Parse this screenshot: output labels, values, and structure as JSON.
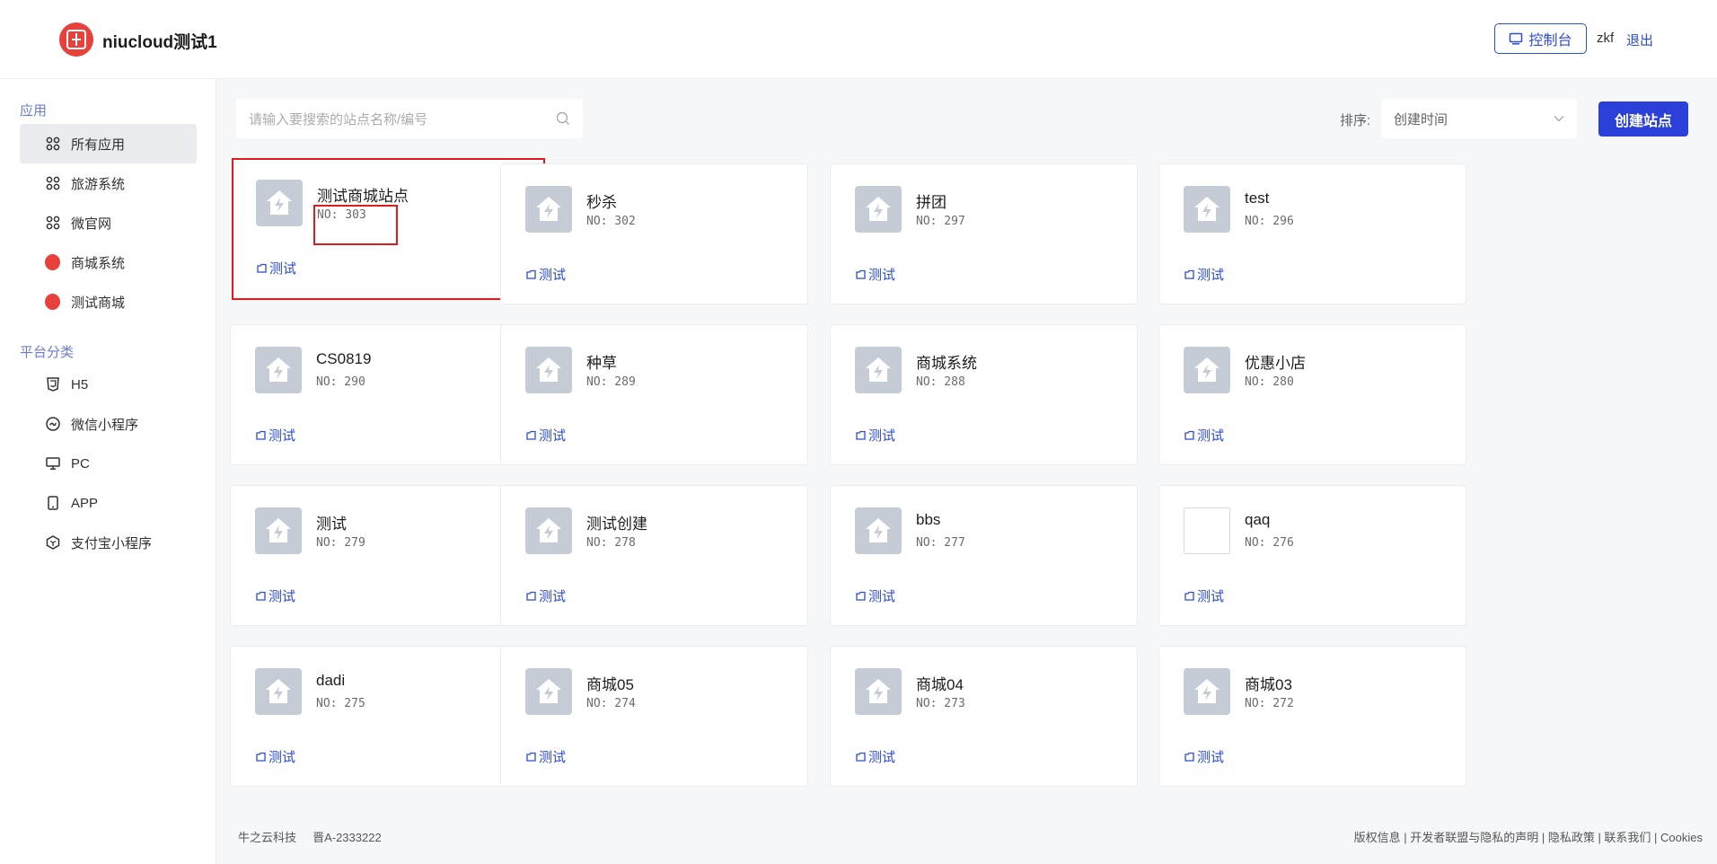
{
  "header": {
    "app_title": "niucloud测试1",
    "console_label": "控制台",
    "user_name": "zkf",
    "logout_label": "退出"
  },
  "sidebar": {
    "section_apps": "应用",
    "apps": [
      {
        "label": "所有应用",
        "icon": "grid-icon",
        "active": true
      },
      {
        "label": "旅游系统",
        "icon": "grid-icon"
      },
      {
        "label": "微官网",
        "icon": "grid-icon"
      },
      {
        "label": "商城系统",
        "icon": "app-logo-icon"
      },
      {
        "label": "测试商城",
        "icon": "app-logo-icon"
      }
    ],
    "section_platforms": "平台分类",
    "platforms": [
      {
        "label": "H5",
        "icon": "html5-icon"
      },
      {
        "label": "微信小程序",
        "icon": "mini-program-icon"
      },
      {
        "label": "PC",
        "icon": "monitor-icon"
      },
      {
        "label": "APP",
        "icon": "phone-icon"
      },
      {
        "label": "支付宝小程序",
        "icon": "alipay-icon"
      }
    ]
  },
  "toolbar": {
    "search_placeholder": "请输入要搜索的站点名称/编号",
    "sort_label": "排序:",
    "sort_value": "创建时间",
    "create_label": "创建站点"
  },
  "sites": [
    {
      "name": "测试商城站点",
      "no": "NO: 303",
      "tag": "测试"
    },
    {
      "name": "秒杀",
      "no": "NO: 302",
      "tag": "测试"
    },
    {
      "name": "拼团",
      "no": "NO: 297",
      "tag": "测试"
    },
    {
      "name": "test",
      "no": "NO: 296",
      "tag": "测试"
    },
    {
      "name": "CS0819",
      "no": "NO: 290",
      "tag": "测试"
    },
    {
      "name": "种草",
      "no": "NO: 289",
      "tag": "测试"
    },
    {
      "name": "商城系统",
      "no": "NO: 288",
      "tag": "测试"
    },
    {
      "name": "优惠小店",
      "no": "NO: 280",
      "tag": "测试"
    },
    {
      "name": "测试",
      "no": "NO: 279",
      "tag": "测试"
    },
    {
      "name": "测试创建",
      "no": "NO: 278",
      "tag": "测试"
    },
    {
      "name": "bbs",
      "no": "NO: 277",
      "tag": "测试"
    },
    {
      "name": "qaq",
      "no": "NO: 276",
      "tag": "测试"
    },
    {
      "name": "dadi",
      "no": "NO: 275",
      "tag": "测试"
    },
    {
      "name": "商城05",
      "no": "NO: 274",
      "tag": "测试"
    },
    {
      "name": "商城04",
      "no": "NO: 273",
      "tag": "测试"
    },
    {
      "name": "商城03",
      "no": "NO: 272",
      "tag": "测试"
    }
  ],
  "footer": {
    "company": "牛之云科技",
    "icp": "晋A-2333222",
    "links": "版权信息 | 开发者联盟与隐私的声明 | 隐私政策 | 联系我们 | Cookies"
  },
  "colors": {
    "accent": "#2b4bd9",
    "brand_red": "#e8403a",
    "highlight": "#e01b1b"
  }
}
